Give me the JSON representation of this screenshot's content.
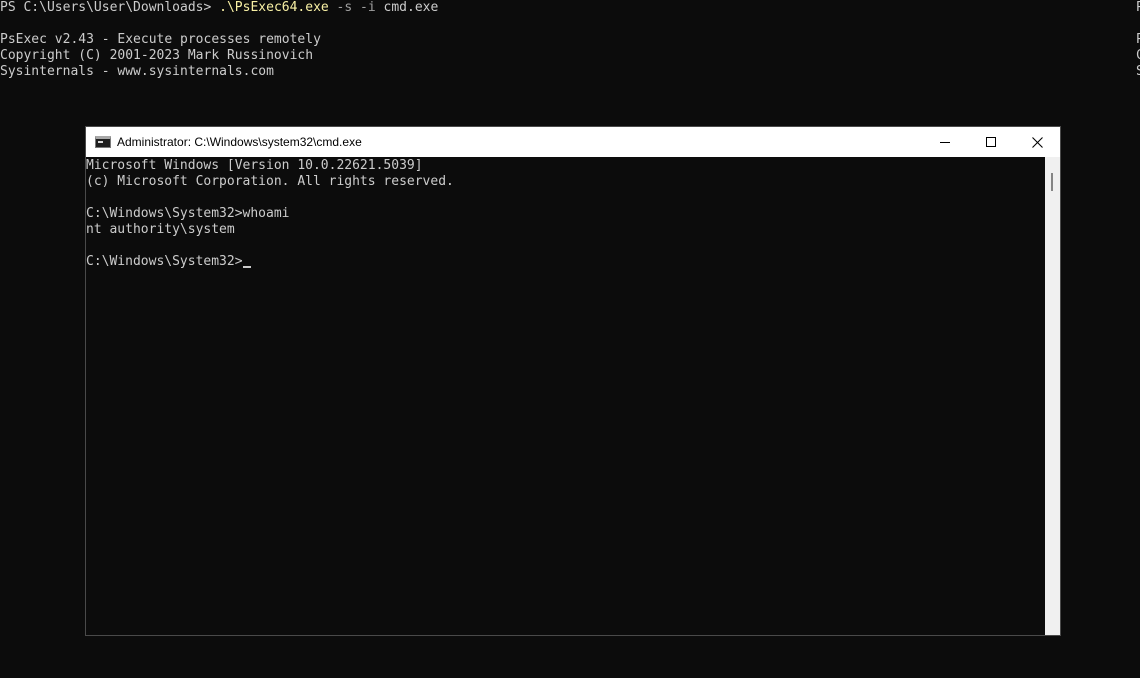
{
  "powershell": {
    "lines": [
      [
        {
          "text": "PS C:\\Users\\User\\Downloads> ",
          "style": "prompt"
        },
        {
          "text": ".\\PsExec64.exe",
          "style": "exe"
        },
        {
          "text": " -s -i",
          "style": "param"
        },
        {
          "text": " cmd.exe",
          "style": "arg"
        }
      ],
      [],
      [
        {
          "text": "PsExec v2.43 - Execute processes remotely",
          "style": "arg"
        }
      ],
      [
        {
          "text": "Copyright (C) 2001-2023 Mark Russinovich",
          "style": "arg"
        }
      ],
      [
        {
          "text": "Sysinternals - www.sysinternals.com",
          "style": "arg"
        }
      ]
    ],
    "right_edge_chars": [
      "P",
      "",
      "P",
      "C",
      "S"
    ]
  },
  "cmd_window": {
    "title": "Administrator: C:\\Windows\\system32\\cmd.exe",
    "controls": [
      "minimize",
      "maximize",
      "close"
    ],
    "lines": [
      "Microsoft Windows [Version 10.0.22621.5039]",
      "(c) Microsoft Corporation. All rights reserved.",
      "",
      "C:\\Windows\\System32>whoami",
      "nt authority\\system",
      "",
      "C:\\Windows\\System32>"
    ]
  },
  "colors": {
    "background": "#0c0c0c",
    "text": "#cccccc",
    "exe_highlight": "#f9f1a5",
    "param_highlight": "#a0a0a0",
    "titlebar": "#ffffff"
  }
}
